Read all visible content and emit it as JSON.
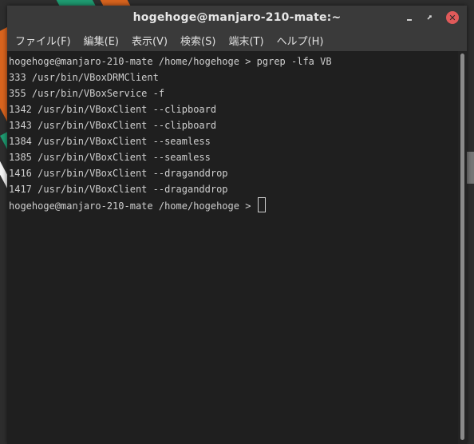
{
  "window": {
    "title": "hogehoge@manjaro-210-mate:~",
    "controls": {
      "minimize_icon": "minimize-icon",
      "maximize_icon": "maximize-icon",
      "close_icon": "close-icon",
      "close_glyph": "✕"
    }
  },
  "menubar": {
    "items": [
      {
        "label": "ファイル(F)"
      },
      {
        "label": "編集(E)"
      },
      {
        "label": "表示(V)"
      },
      {
        "label": "検索(S)"
      },
      {
        "label": "端末(T)"
      },
      {
        "label": "ヘルプ(H)"
      }
    ]
  },
  "terminal": {
    "lines": [
      "hogehoge@manjaro-210-mate /home/hogehoge > pgrep -lfa VB",
      "333 /usr/bin/VBoxDRMClient",
      "355 /usr/bin/VBoxService -f",
      "1342 /usr/bin/VBoxClient --clipboard",
      "1343 /usr/bin/VBoxClient --clipboard",
      "1384 /usr/bin/VBoxClient --seamless",
      "1385 /usr/bin/VBoxClient --seamless",
      "1416 /usr/bin/VBoxClient --draganddrop",
      "1417 /usr/bin/VBoxClient --draganddrop"
    ],
    "prompt": "hogehoge@manjaro-210-mate /home/hogehoge > "
  },
  "colors": {
    "desktop_orange": "#d9641e",
    "desktop_green": "#1f9c72",
    "desktop_teal": "#0f6f55",
    "terminal_bg": "#1f1f1f",
    "terminal_fg": "#cfcfcf",
    "titlebar_bg": "#3a3a3a",
    "close_button": "#e05a5a"
  }
}
